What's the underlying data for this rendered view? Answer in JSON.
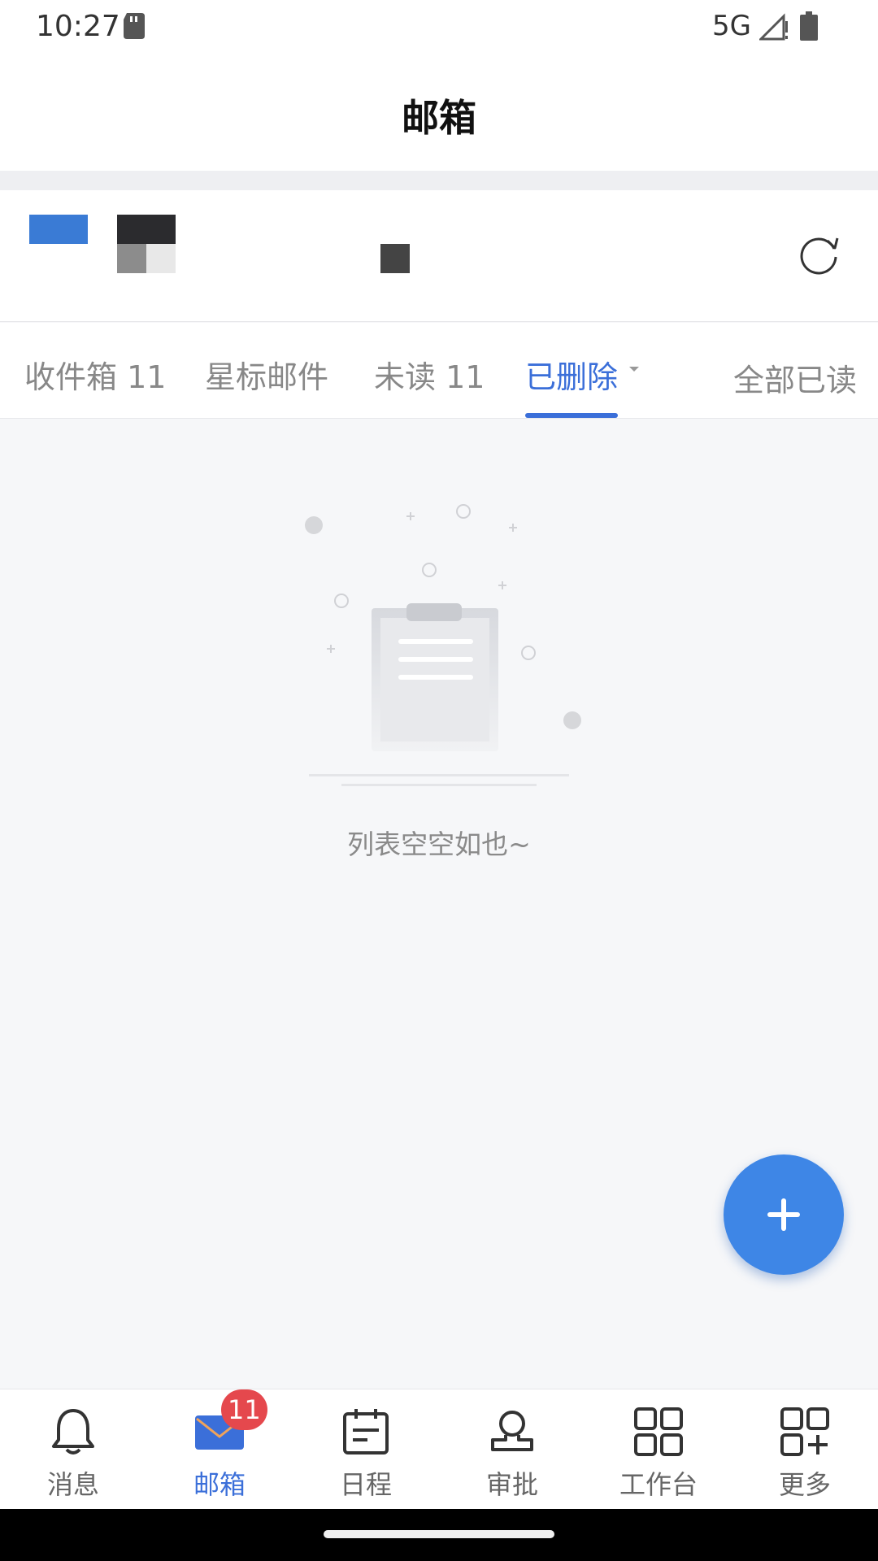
{
  "status_bar": {
    "time": "10:27",
    "network": "5G",
    "icons": [
      "sd-card-icon",
      "signal-icon",
      "battery-icon"
    ]
  },
  "header": {
    "title": "邮箱"
  },
  "account": {
    "refresh_icon": "refresh-icon",
    "colors": {
      "avatar": "#3a7bd5"
    }
  },
  "tabs": [
    {
      "label": "收件箱 11",
      "active": false
    },
    {
      "label": "星标邮件",
      "active": false
    },
    {
      "label": "未读 11",
      "active": false
    },
    {
      "label": "已删除",
      "active": true,
      "icon": "chevron-down-icon"
    }
  ],
  "mark_all_read": "全部已读",
  "empty_state": {
    "text": "列表空空如也~",
    "icon": "clipboard-icon"
  },
  "fab": {
    "icon": "plus-icon"
  },
  "bottom_nav": [
    {
      "label": "消息",
      "icon": "bell-icon",
      "active": false
    },
    {
      "label": "邮箱",
      "icon": "mail-icon",
      "active": true,
      "badge": "11"
    },
    {
      "label": "日程",
      "icon": "calendar-icon",
      "active": false
    },
    {
      "label": "审批",
      "icon": "approval-icon",
      "active": false
    },
    {
      "label": "工作台",
      "icon": "grid-icon",
      "active": false
    },
    {
      "label": "更多",
      "icon": "grid-plus-icon",
      "active": false
    }
  ],
  "colors": {
    "accent": "#3b6fd9",
    "fab": "#3e86e6",
    "badge": "#e5484d"
  }
}
